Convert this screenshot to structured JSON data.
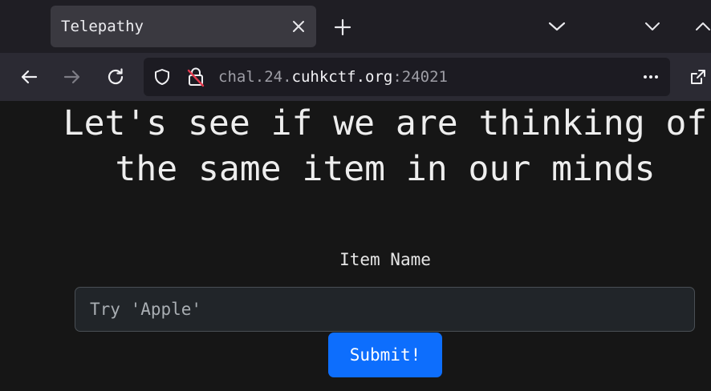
{
  "browser": {
    "tab": {
      "title": "Telepathy"
    },
    "url": {
      "prefix": "chal.24.",
      "domain": "cuhkctf.org",
      "port": ":24021"
    },
    "icons": {
      "close": "close-icon",
      "new_tab": "plus-icon",
      "back": "arrow-left-icon",
      "forward": "arrow-right-icon",
      "reload": "reload-icon",
      "shield": "shield-icon",
      "lock": "insecure-lock-icon",
      "more": "more-icon",
      "extensions": "extension-icon"
    }
  },
  "page": {
    "heading": "Let's see if we are thinking of the same item in our minds",
    "label": "Item Name",
    "input": {
      "placeholder": "Try 'Apple'",
      "value": ""
    },
    "submit_label": "Submit!"
  },
  "colors": {
    "accent": "#0d6efd",
    "page_bg": "#161616",
    "tab_bg": "#3a3940",
    "toolbar_bg": "#2b2a33"
  }
}
